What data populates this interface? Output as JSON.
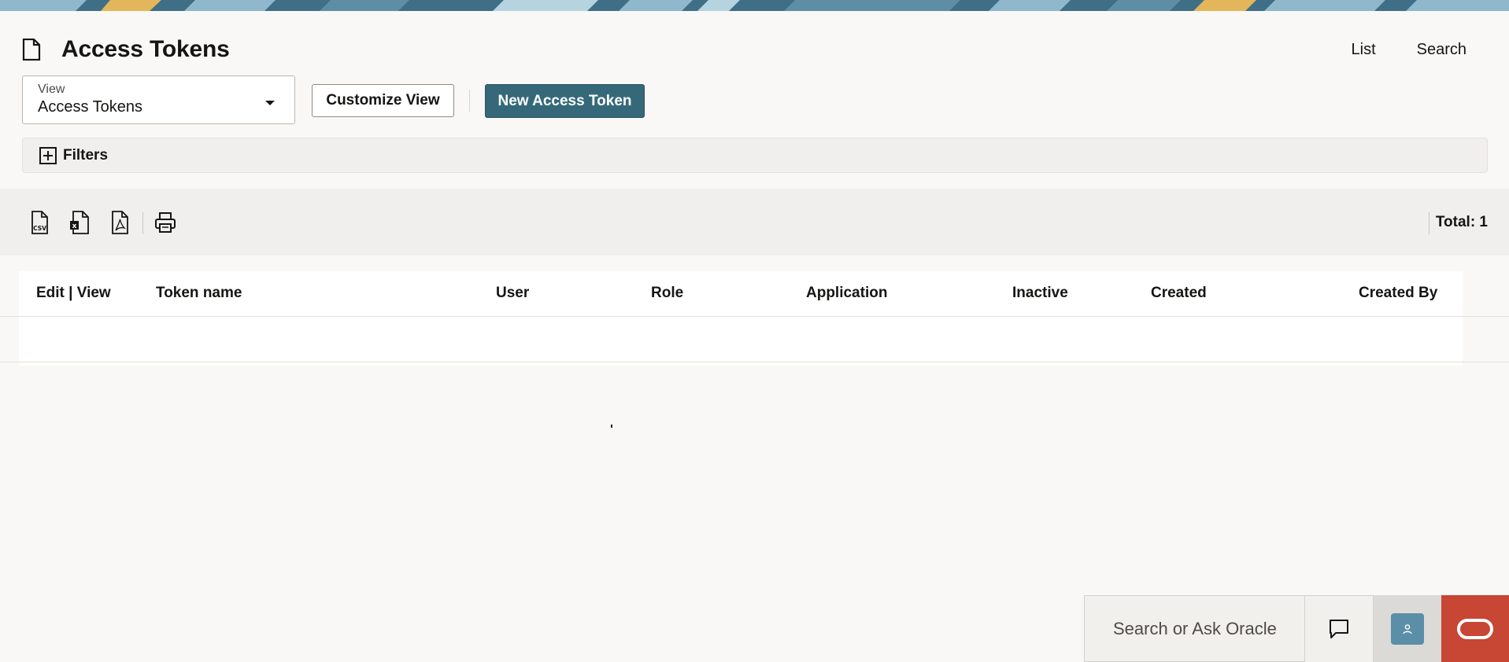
{
  "header": {
    "title": "Access Tokens",
    "links": [
      "List",
      "Search"
    ]
  },
  "view_select": {
    "label": "View",
    "value": "Access Tokens"
  },
  "buttons": {
    "customize": "Customize View",
    "new_token": "New Access Token"
  },
  "filters": {
    "label": "Filters"
  },
  "toolbar": {
    "icons": [
      "csv-export-icon",
      "excel-export-icon",
      "pdf-export-icon",
      "print-icon"
    ],
    "total": "Total: 1"
  },
  "table": {
    "columns": [
      "Edit | View",
      "Token name",
      "User",
      "Role",
      "Application",
      "Inactive",
      "Created",
      "Created By"
    ]
  },
  "footer": {
    "search_placeholder": "Search or Ask Oracle",
    "icons": [
      "chat-icon",
      "user-avatar-icon",
      "oracle-logo-icon"
    ]
  },
  "colors": {
    "primary_button": "#356979",
    "oracle_red": "#c74634",
    "avatar": "#5b8ea7",
    "background": "#f9f8f6"
  }
}
